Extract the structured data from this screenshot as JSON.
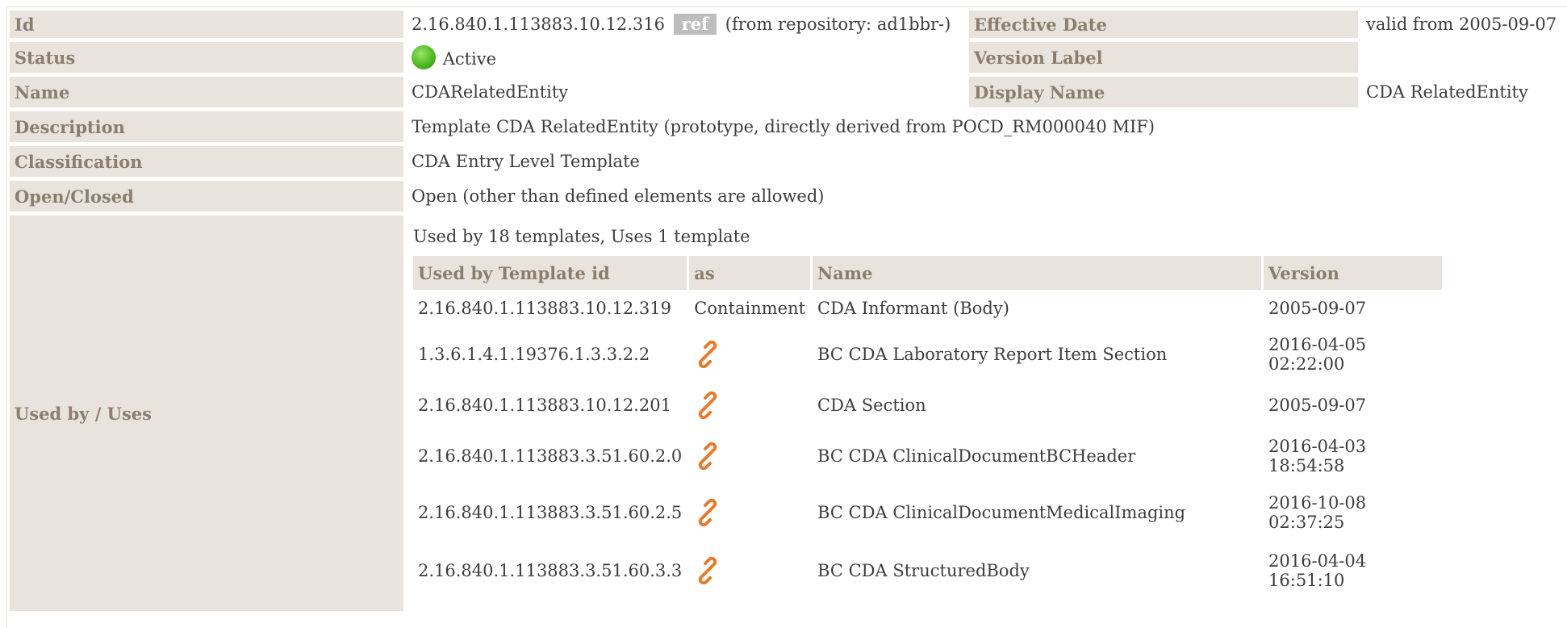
{
  "meta": {
    "id_label": "Id",
    "id_value": "2.16.840.1.113883.10.12.316",
    "ref_badge": "ref",
    "repository_note": "(from repository: ad1bbr-)",
    "effective_date_label": "Effective Date",
    "effective_date_value": "valid from 2005-09-07",
    "status_label": "Status",
    "status_value": "Active",
    "version_label_label": "Version Label",
    "version_label_value": "",
    "name_label": "Name",
    "name_value": "CDARelatedEntity",
    "display_name_label": "Display Name",
    "display_name_value": "CDA RelatedEntity",
    "description_label": "Description",
    "description_value": "Template CDA RelatedEntity (prototype, directly derived from POCD_RM000040 MIF)",
    "classification_label": "Classification",
    "classification_value": "CDA Entry Level Template",
    "open_closed_label": "Open/Closed",
    "open_closed_value": "Open (other than defined elements are allowed)",
    "used_by_label": "Used by / Uses"
  },
  "usage": {
    "caption": "Used by 18 templates, Uses 1 template",
    "headers": {
      "template_id": "Used by Template id",
      "as": "as",
      "name": "Name",
      "version": "Version"
    },
    "rows": [
      {
        "template_id": "2.16.840.1.113883.10.12.319",
        "as": "Containment",
        "name": "CDA Informant (Body)",
        "version_1": "2005-09-07",
        "version_2": ""
      },
      {
        "template_id": "1.3.6.1.4.1.19376.1.3.3.2.2",
        "as": "",
        "name": "BC CDA Laboratory Report Item Section",
        "version_1": "2016-04-05",
        "version_2": "02:22:00"
      },
      {
        "template_id": "2.16.840.1.113883.10.12.201",
        "as": "",
        "name": "CDA Section",
        "version_1": "2005-09-07",
        "version_2": ""
      },
      {
        "template_id": "2.16.840.1.113883.3.51.60.2.0",
        "as": "",
        "name": "BC CDA ClinicalDocumentBCHeader",
        "version_1": "2016-04-03",
        "version_2": "18:54:58"
      },
      {
        "template_id": "2.16.840.1.113883.3.51.60.2.5",
        "as": "",
        "name": "BC CDA ClinicalDocumentMedicalImaging",
        "version_1": "2016-10-08",
        "version_2": "02:37:25"
      },
      {
        "template_id": "2.16.840.1.113883.3.51.60.3.3",
        "as": "",
        "name": "BC CDA StructuredBody",
        "version_1": "2016-04-04",
        "version_2": "16:51:10"
      }
    ],
    "link_icon": "chain-link-icon",
    "link_icon_color": "#e87a2d"
  },
  "colors": {
    "label_bg": "#e8e4dd",
    "label_text": "#8b7e6f",
    "badge_bg": "#bdbdbd",
    "status_green": "#4cbb22"
  }
}
